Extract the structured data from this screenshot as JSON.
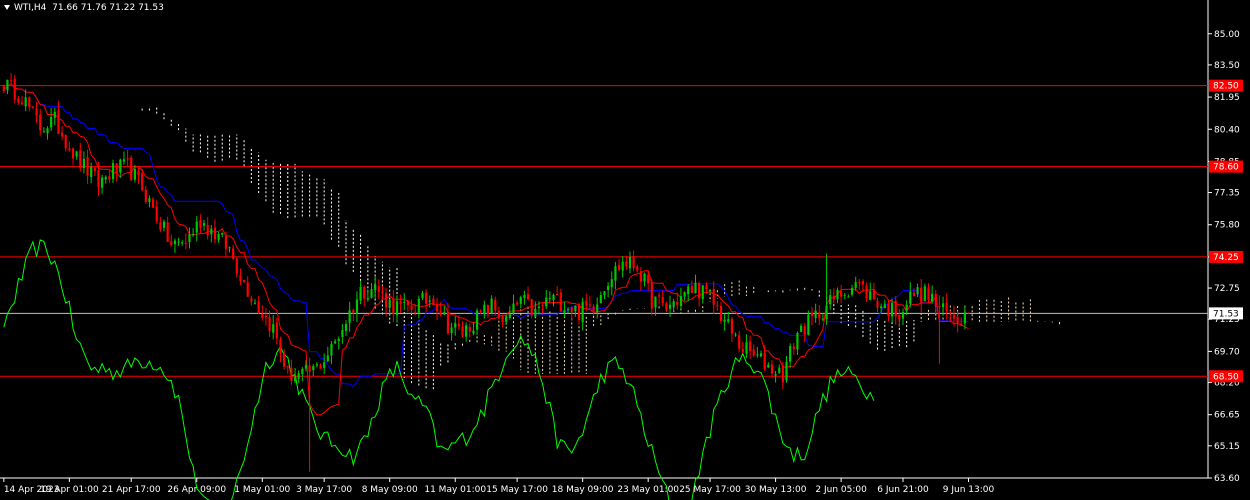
{
  "symbol": "WTI,H4",
  "ohlc": {
    "open": "71.66",
    "high": "71.76",
    "low": "71.22",
    "close": "71.53"
  },
  "colors": {
    "background": "#000000",
    "bull": "#00c800",
    "bear": "#ff0000",
    "tenkan": "#ff0000",
    "kijun": "#0000ff",
    "chikou": "#00ff00",
    "level": "#ff0000",
    "level_label_bg": "#ff0000",
    "current_line": "#c0c0c0",
    "cloud_up": "#f5deb3",
    "cloud_down": "#ffffff",
    "axis_text": "#ffffff"
  },
  "chart_data": {
    "type": "candlestick",
    "instrument": "WTI",
    "timeframe": "H4",
    "ylim": [
      63.6,
      86.0
    ],
    "y_ticks": [
      "85.00",
      "83.50",
      "81.95",
      "80.40",
      "78.85",
      "77.35",
      "75.80",
      "74.25",
      "72.75",
      "71.25",
      "69.70",
      "68.20",
      "66.65",
      "65.15",
      "63.60"
    ],
    "x_ticks": [
      "14 Apr 2023",
      "19 Apr 01:00",
      "21 Apr 17:00",
      "26 Apr 09:00",
      "1 May 01:00",
      "3 May 17:00",
      "8 May 09:00",
      "11 May 01:00",
      "15 May 17:00",
      "18 May 09:00",
      "23 May 01:00",
      "25 May 17:00",
      "30 May 13:00",
      "2 Jun 05:00",
      "6 Jun 21:00",
      "9 Jun 13:00"
    ],
    "levels": [
      {
        "value": 82.5,
        "label": "82.50"
      },
      {
        "value": 78.6,
        "label": "78.60"
      },
      {
        "value": 74.25,
        "label": "74.25"
      },
      {
        "value": 68.5,
        "label": "68.50"
      }
    ],
    "current_price": {
      "value": 71.53,
      "label": "71.53"
    },
    "price_keypoints": [
      [
        0,
        82.6
      ],
      [
        5,
        82.0
      ],
      [
        10,
        80.5
      ],
      [
        14,
        80.8
      ],
      [
        20,
        79.0
      ],
      [
        26,
        77.8
      ],
      [
        30,
        78.4
      ],
      [
        34,
        78.6
      ],
      [
        38,
        77.6
      ],
      [
        42,
        76.2
      ],
      [
        46,
        74.8
      ],
      [
        50,
        75.0
      ],
      [
        54,
        76.0
      ],
      [
        58,
        75.4
      ],
      [
        62,
        74.6
      ],
      [
        66,
        73.0
      ],
      [
        70,
        71.8
      ],
      [
        74,
        70.8
      ],
      [
        78,
        68.6
      ],
      [
        82,
        68.5
      ],
      [
        86,
        68.9
      ],
      [
        90,
        69.8
      ],
      [
        94,
        71.2
      ],
      [
        98,
        72.6
      ],
      [
        102,
        72.8
      ],
      [
        106,
        72.0
      ],
      [
        110,
        71.7
      ],
      [
        114,
        72.0
      ],
      [
        118,
        72.3
      ],
      [
        122,
        71.0
      ],
      [
        126,
        70.6
      ],
      [
        130,
        71.3
      ],
      [
        134,
        71.9
      ],
      [
        138,
        71.1
      ],
      [
        142,
        72.2
      ],
      [
        146,
        71.5
      ],
      [
        150,
        72.3
      ],
      [
        154,
        72.0
      ],
      [
        158,
        71.6
      ],
      [
        162,
        72.0
      ],
      [
        166,
        73.2
      ],
      [
        170,
        74.0
      ],
      [
        174,
        73.8
      ],
      [
        178,
        72.2
      ],
      [
        182,
        71.8
      ],
      [
        186,
        72.3
      ],
      [
        190,
        72.8
      ],
      [
        194,
        72.3
      ],
      [
        198,
        71.2
      ],
      [
        202,
        70.0
      ],
      [
        206,
        69.5
      ],
      [
        210,
        69.0
      ],
      [
        214,
        68.6
      ],
      [
        218,
        70.6
      ],
      [
        222,
        71.2
      ],
      [
        226,
        71.9
      ],
      [
        230,
        72.5
      ],
      [
        234,
        73.0
      ],
      [
        238,
        72.4
      ],
      [
        242,
        71.8
      ],
      [
        246,
        71.6
      ],
      [
        250,
        72.5
      ],
      [
        254,
        72.4
      ],
      [
        258,
        71.6
      ],
      [
        262,
        71.3
      ],
      [
        265,
        71.53
      ]
    ],
    "shocks": [
      {
        "index": 84,
        "high": 69.4,
        "low": 63.9
      },
      {
        "index": 226,
        "high": 74.4,
        "low": 71.5
      },
      {
        "index": 257,
        "high": 72.4,
        "low": 69.1
      }
    ],
    "bars": 266,
    "cloud_shift": 26
  }
}
